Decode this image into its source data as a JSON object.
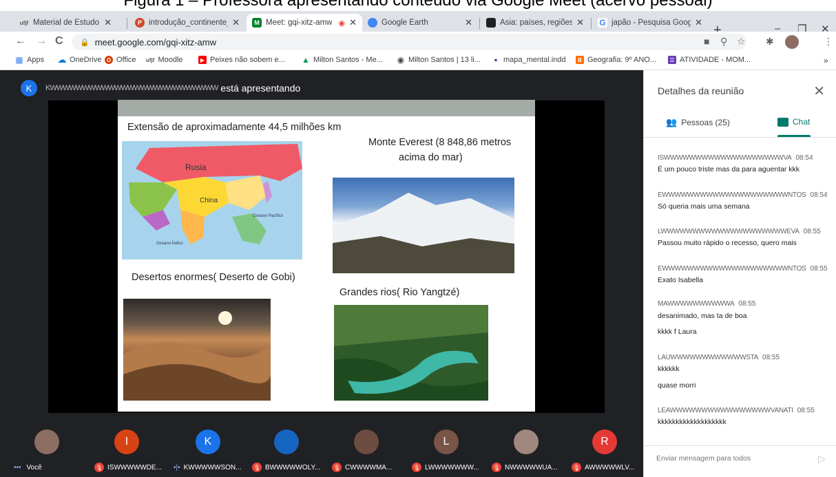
{
  "caption": "Figura 1 – Professora apresentando conteúdo via Google Meet (acervo pessoal)",
  "tabs": [
    {
      "label": "Material de Estudo - Ge",
      "fav": "ufjf",
      "color": "#ffffff"
    },
    {
      "label": "introdução_continente_",
      "fav": "P",
      "color": "#d24726"
    },
    {
      "label": "Meet: gqi-xitz-amw",
      "fav": "M",
      "color": "#00832d"
    },
    {
      "label": "Google Earth",
      "fav": "E",
      "color": "#4285f4"
    },
    {
      "label": "Ásia: países, regiões e t",
      "fav": "■",
      "color": "#202124"
    },
    {
      "label": "japão - Pesquisa Googl",
      "fav": "G",
      "color": "#4285f4"
    }
  ],
  "window": {
    "minimize": "–",
    "restore": "❐",
    "close": "✕",
    "newtab": "+"
  },
  "address": {
    "url": "meet.google.com/gqi-xitz-amw",
    "back": "←",
    "forward": "→",
    "reload": "C"
  },
  "bookmarks": [
    {
      "label": "Apps",
      "fav": "▦",
      "color": "#4285f4"
    },
    {
      "label": "OneDrive",
      "fav": "☁",
      "color": "#0078d4"
    },
    {
      "label": "Office",
      "fav": "O",
      "color": "#d83b01"
    },
    {
      "label": "Moodle",
      "fav": "u",
      "color": "#888888"
    },
    {
      "label": "Peixes não sobem e...",
      "fav": "▶",
      "color": "#ff0000"
    },
    {
      "label": "Milton Santos - Me...",
      "fav": "▲",
      "color": "#0f9d58"
    },
    {
      "label": "Milton Santos | 13 li...",
      "fav": "◉",
      "color": "#444444"
    },
    {
      "label": "mapa_mental.indd",
      "fav": "▪",
      "color": "#1a237e"
    },
    {
      "label": "Geografia: 9º ANO...",
      "fav": "B",
      "color": "#ff6d00"
    },
    {
      "label": "ATIVIDADE - MOM...",
      "fav": "☰",
      "color": "#673ab7"
    }
  ],
  "presenter": {
    "initial": "K",
    "name": "KWWWWWWWWWWWWWWWWWWWWWWWWWW",
    "suffix": "está apresentando"
  },
  "slide": {
    "extent": "Extensão de aproximadamente 44,5 milhões km",
    "everest": "Monte Everest (8 848,86 metros",
    "everest2": "acima  do mar)",
    "deserts": "Desertos enormes( Deserto de Gobi)",
    "rivers": "Grandes rios( Rio Yangtzé)",
    "map_russia": "Rusia",
    "map_china": "China",
    "map_pacific": "Oceano Pacífico",
    "map_indian": "Oceano Índico"
  },
  "participants": [
    {
      "name": "Você",
      "initial": "",
      "color": "#8d6e63",
      "muted": false
    },
    {
      "name": "ISWWWWWDE...",
      "initial": "I",
      "color": "#d84315",
      "muted": true
    },
    {
      "name": "KWWWWWSON...",
      "initial": "K",
      "color": "#1a73e8",
      "muted": false
    },
    {
      "name": "BWWWWWOLY...",
      "initial": "",
      "color": "#1565c0",
      "muted": true
    },
    {
      "name": "CWWWWMA...",
      "initial": "",
      "color": "#6d4c41",
      "muted": true
    },
    {
      "name": "LWWWWWWW...",
      "initial": "L",
      "color": "#795548",
      "muted": true
    },
    {
      "name": "NWWWWWUA...",
      "initial": "",
      "color": "#a1887f",
      "muted": true
    },
    {
      "name": "AWWWWWLV...",
      "initial": "R",
      "color": "#e53935",
      "muted": true
    }
  ],
  "panel": {
    "title": "Detalhes da reunião",
    "close": "✕",
    "people_tab": "Pessoas (25)",
    "chat_tab": "Chat",
    "messages": [
      {
        "name": "ISWWWWWWWWWWWWWWWWWWWVA",
        "time": "08:54",
        "lines": [
          "É um pouco triste mas da para aguentar kkk"
        ]
      },
      {
        "name": "EWWWWWWWWWWWWWWWWWWWWNTOS",
        "time": "08:54",
        "lines": [
          "Só queria mais uma semana"
        ]
      },
      {
        "name": "LWWWWWWWWWWWWWWWWWWWWEVA",
        "time": "08:55",
        "lines": [
          "Passou muito rápido o recesso, quero mais"
        ]
      },
      {
        "name": "EWWWWWWWWWWWWWWWWWWWWNTOS",
        "time": "08:55",
        "lines": [
          "Exato Isabella"
        ]
      },
      {
        "name": "MAWWWWWWWWWWA",
        "time": "08:55",
        "lines": [
          "desanimado, mas ta de boa",
          "kkkk f Laura"
        ]
      },
      {
        "name": "LAUWWWWWWWWWWWWSTA",
        "time": "08:55",
        "lines": [
          "kkkkkk",
          "quase morri"
        ]
      },
      {
        "name": "LEAWWWWWWWWWWWWWWWWVANATI",
        "time": "08:55",
        "lines": [
          "kkkkkkkkkkkkkkkkkkk"
        ]
      }
    ],
    "compose_placeholder": "Enviar mensagem para todos"
  }
}
